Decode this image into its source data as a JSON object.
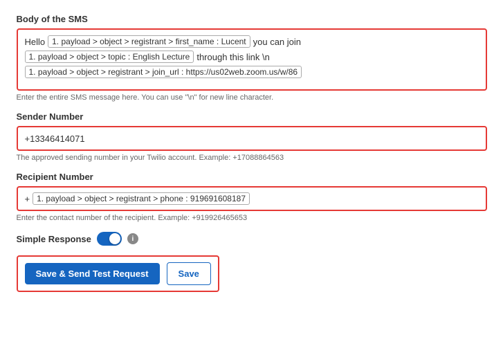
{
  "sms_body": {
    "label": "Body of the SMS",
    "lines": [
      {
        "parts": [
          {
            "type": "plain",
            "text": "Hello"
          },
          {
            "type": "token",
            "text": "1. payload > object > registrant > first_name : Lucent"
          },
          {
            "type": "plain",
            "text": "you can join"
          }
        ]
      },
      {
        "parts": [
          {
            "type": "token",
            "text": "1. payload > object > topic : English Lecture"
          },
          {
            "type": "plain",
            "text": "through this link \\n"
          }
        ]
      },
      {
        "parts": [
          {
            "type": "token",
            "text": "1. payload > object > registrant > join_url : https://us02web.zoom.us/w/86"
          }
        ]
      }
    ],
    "hint": "Enter the entire SMS message here. You can use \"\\n\" for new line character."
  },
  "sender_number": {
    "label": "Sender Number",
    "value": "+13346414071",
    "hint": "The approved sending number in your Twilio account. Example: +17088864563"
  },
  "recipient_number": {
    "label": "Recipient Number",
    "prefix": "+",
    "token": "1. payload > object > registrant > phone : 919691608187",
    "hint": "Enter the contact number of the recipient. Example: +919926465653"
  },
  "simple_response": {
    "label": "Simple Response"
  },
  "buttons": {
    "save_send_label": "Save & Send Test Request",
    "save_label": "Save"
  }
}
